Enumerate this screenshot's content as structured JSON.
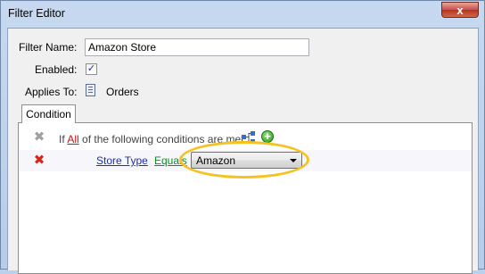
{
  "window": {
    "title": "Filter Editor",
    "close_glyph": "x"
  },
  "form": {
    "filter_name_label": "Filter Name:",
    "filter_name_value": "Amazon Store",
    "enabled_label": "Enabled:",
    "enabled_checked": true,
    "applies_to_label": "Applies To:",
    "applies_to_value": "Orders"
  },
  "tabs": [
    {
      "label": "Condition",
      "selected": true
    }
  ],
  "condition_header": {
    "prefix": "If",
    "quantifier": "All",
    "suffix": "of the following conditions are met"
  },
  "conditions": [
    {
      "field": "Store Type",
      "operator": "Equals",
      "value": "Amazon"
    }
  ],
  "icons": {
    "header_remove": "remove-icon-disabled",
    "row_remove": "remove-icon",
    "group": "condition-group-icon",
    "add": "add-condition-icon",
    "orders": "orders-icon"
  },
  "colors": {
    "highlight": "#f5c220",
    "remove_red": "#d8241c",
    "link_blue": "#1f30a9",
    "operator_green": "#138a2b",
    "quantifier_red": "#c2141a"
  }
}
